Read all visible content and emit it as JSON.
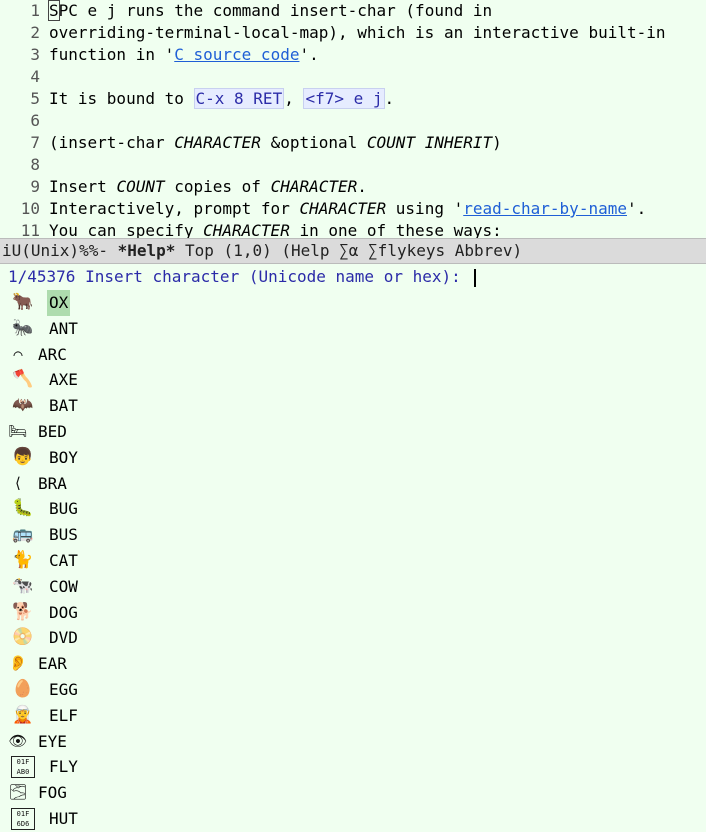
{
  "help": {
    "lines": [
      {
        "n": "1",
        "parts": [
          {
            "t": "S",
            "c": "cursor-box"
          },
          {
            "t": "PC e j runs the command insert-char (found in"
          }
        ]
      },
      {
        "n": "2",
        "parts": [
          {
            "t": "overriding-terminal-local-map), which is an interactive built-in"
          }
        ]
      },
      {
        "n": "3",
        "parts": [
          {
            "t": "function in '"
          },
          {
            "t": "C source code",
            "c": "link"
          },
          {
            "t": "'."
          }
        ]
      },
      {
        "n": "4",
        "parts": []
      },
      {
        "n": "5",
        "parts": [
          {
            "t": "It is bound to "
          },
          {
            "t": "C-x 8 RET",
            "c": "key"
          },
          {
            "t": ", "
          },
          {
            "t": "<f7> e j",
            "c": "key"
          },
          {
            "t": "."
          }
        ]
      },
      {
        "n": "6",
        "parts": []
      },
      {
        "n": "7",
        "parts": [
          {
            "t": "(insert-char "
          },
          {
            "t": "CHARACTER",
            "c": "em"
          },
          {
            "t": " &optional "
          },
          {
            "t": "COUNT",
            "c": "em"
          },
          {
            "t": " "
          },
          {
            "t": "INHERIT",
            "c": "em"
          },
          {
            "t": ")"
          }
        ]
      },
      {
        "n": "8",
        "parts": []
      },
      {
        "n": "9",
        "parts": [
          {
            "t": "Insert "
          },
          {
            "t": "COUNT",
            "c": "em"
          },
          {
            "t": " copies of "
          },
          {
            "t": "CHARACTER",
            "c": "em"
          },
          {
            "t": "."
          }
        ]
      },
      {
        "n": "10",
        "parts": [
          {
            "t": "Interactively, prompt for "
          },
          {
            "t": "CHARACTER",
            "c": "em"
          },
          {
            "t": " using '"
          },
          {
            "t": "read-char-by-name",
            "c": "link"
          },
          {
            "t": "'."
          }
        ]
      },
      {
        "n": "11",
        "parts": [
          {
            "t": "You can specify "
          },
          {
            "t": "CHARACTER",
            "c": "em"
          },
          {
            "t": " in one of these ways:"
          }
        ]
      }
    ]
  },
  "modeline": {
    "prefix": "iU(Unix)%%- ",
    "buffer": "*Help*",
    "rest": " Top (1,0) (Help ∑α ∑flykeys Abbrev)"
  },
  "minibuffer": {
    "count": "1/45376",
    "prompt": " Insert character (Unicode name or hex): ",
    "input": ""
  },
  "candidates": [
    {
      "glyph": "🐂",
      "name": "OX",
      "selected": true
    },
    {
      "glyph": "🐜",
      "name": "ANT"
    },
    {
      "glyph": "⌒",
      "name": "ARC",
      "small": true
    },
    {
      "glyph": "🪓",
      "name": "AXE"
    },
    {
      "glyph": "🦇",
      "name": "BAT"
    },
    {
      "glyph": "🛏",
      "name": "BED",
      "small": true
    },
    {
      "glyph": "👦",
      "name": "BOY"
    },
    {
      "glyph": "⟨",
      "name": "BRA",
      "small": true
    },
    {
      "glyph": "🐛",
      "name": "BUG"
    },
    {
      "glyph": "🚌",
      "name": "BUS"
    },
    {
      "glyph": "🐈",
      "name": "CAT"
    },
    {
      "glyph": "🐄",
      "name": "COW"
    },
    {
      "glyph": "🐕",
      "name": "DOG"
    },
    {
      "glyph": "📀",
      "name": "DVD"
    },
    {
      "glyph": "👂",
      "name": "EAR",
      "small": true
    },
    {
      "glyph": "🥚",
      "name": "EGG"
    },
    {
      "glyph": "🧝",
      "name": "ELF"
    },
    {
      "glyph": "👁",
      "name": "EYE",
      "small": true
    },
    {
      "glyph": "01F\nAB0",
      "name": "FLY",
      "tag": true
    },
    {
      "glyph": "🌫",
      "name": "FOG",
      "small": true
    },
    {
      "glyph": "01F\n6D6",
      "name": "HUT",
      "tag": true
    }
  ]
}
